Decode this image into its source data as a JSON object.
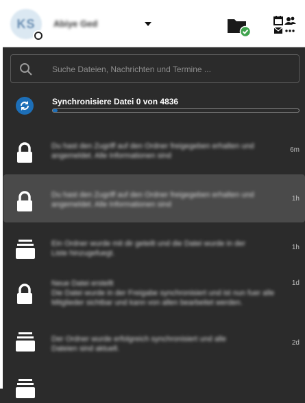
{
  "header": {
    "avatar_initials": "KS",
    "user_name": "Abiye Ged",
    "files_icon": "folder-check-icon",
    "apps_icon": "calendar-contacts-mail-more-icon"
  },
  "search": {
    "placeholder": "Suche Dateien, Nachrichten und Termine ..."
  },
  "sync": {
    "text": "Synchronisiere Datei 0 von 4836",
    "progress": 0.02
  },
  "notifications": [
    {
      "icon": "lock-icon",
      "line1": "Du hast den Zugriff auf den Ordner freigegeben erhalten und",
      "line2": "angemeldet. Alle Informationen sind",
      "time": "6m"
    },
    {
      "icon": "lock-icon",
      "line1": "Du hast den Zugriff auf den Ordner freigegeben erhalten und",
      "line2": "angemeldet. Alle Informationen sind",
      "time": "1h"
    },
    {
      "icon": "archive-icon",
      "line1": "Ein Ordner wurde mit dir geteilt und die Datei wurde in der",
      "line2": "Liste hinzugefuegt.",
      "time": "1h"
    },
    {
      "icon": "lock-icon",
      "line1": "Neue Datei erstellt",
      "line2": "Die Datei wurde in der Freigabe synchronisiert und ist nun fuer alle",
      "line3": "Mitglieder sichtbar und kann von allen bearbeitet werden.",
      "time": "1d"
    },
    {
      "icon": "archive-icon",
      "line1": "Der Ordner wurde erfolgreich synchronisiert und alle",
      "line2": "Dateien sind aktuell.",
      "time": "2d"
    }
  ]
}
